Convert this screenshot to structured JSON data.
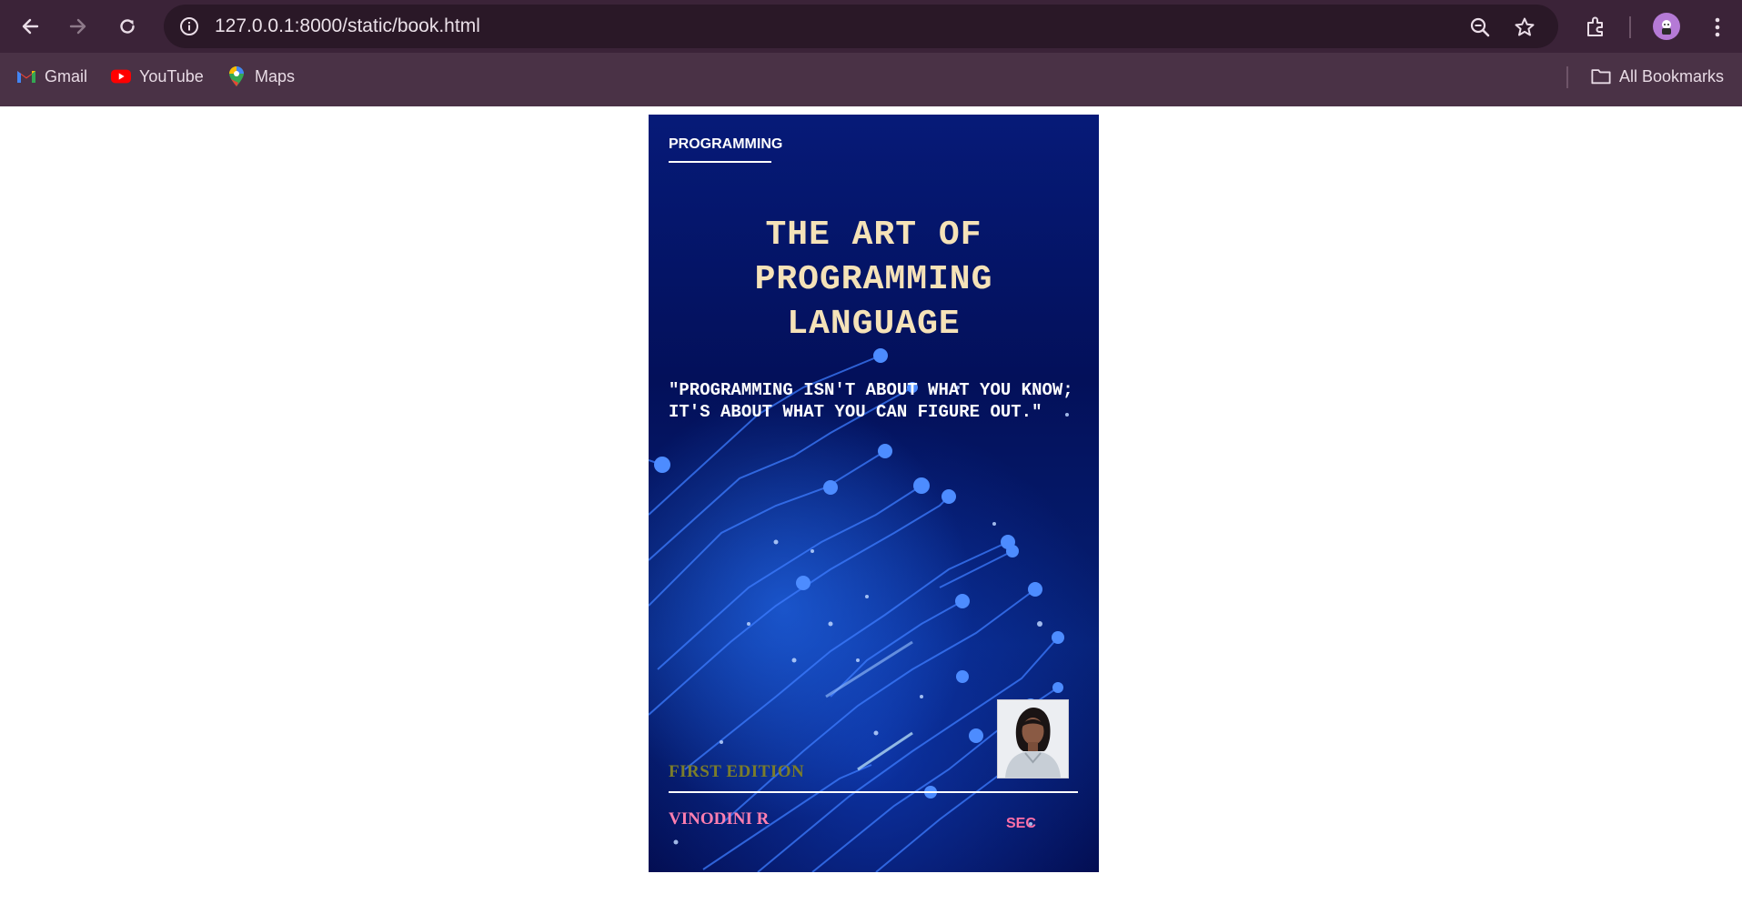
{
  "browser": {
    "url": "127.0.0.1:8000/static/book.html",
    "bookmarks": [
      {
        "label": "Gmail",
        "icon": "gmail-icon"
      },
      {
        "label": "YouTube",
        "icon": "youtube-icon"
      },
      {
        "label": "Maps",
        "icon": "maps-icon"
      }
    ],
    "all_bookmarks_label": "All Bookmarks"
  },
  "book": {
    "category": "PROGRAMMING",
    "title_lines": [
      "THE ART OF",
      "PROGRAMMING",
      "LANGUAGE"
    ],
    "quote": "\"PROGRAMMING ISN'T ABOUT WHAT YOU KNOW; IT'S ABOUT WHAT YOU CAN FIGURE OUT.\"",
    "edition": "FIRST EDITION",
    "author": "VINODINI R",
    "publisher": "SEC",
    "colors": {
      "title": "#f5e2b8",
      "edition": "#7b7d2a",
      "author": "#ff7fb0",
      "publisher": "#ff6fa8",
      "background": "#03105a"
    }
  }
}
